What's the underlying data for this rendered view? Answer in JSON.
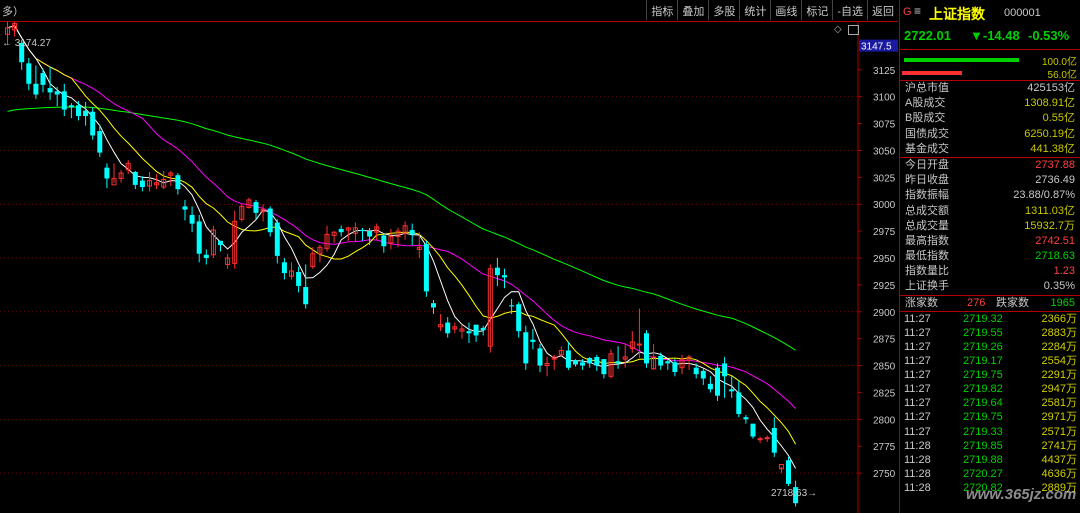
{
  "header": {
    "mode_label": "多）"
  },
  "toolbar": [
    "指标",
    "叠加",
    "多股",
    "统计",
    "画线",
    "标记",
    "-自选",
    "返回"
  ],
  "chart": {
    "high_label": "3174.27",
    "low_label": "2718.63",
    "current_price_tag": "3147.5",
    "y_ticks": [
      "3125",
      "3100",
      "3075",
      "3050",
      "3025",
      "3000",
      "2975",
      "2950",
      "2925",
      "2900",
      "2875",
      "2850",
      "2825",
      "2800",
      "2775",
      "2750"
    ]
  },
  "chart_data": {
    "type": "candlestick",
    "ylim": [
      2725,
      3162
    ],
    "candles": [
      [
        3158,
        3164,
        3148,
        3174
      ],
      [
        3162,
        3168,
        3156,
        3174
      ],
      [
        3150,
        3132,
        3125,
        3152
      ],
      [
        3131,
        3112,
        3106,
        3136
      ],
      [
        3112,
        3102,
        3098,
        3129
      ],
      [
        3122,
        3111,
        3104,
        3126
      ],
      [
        3108,
        3104,
        3097,
        3128
      ],
      [
        3105,
        3102,
        3091,
        3109
      ],
      [
        3105,
        3088,
        3082,
        3112
      ],
      [
        3092,
        3090,
        3080,
        3094
      ],
      [
        3092,
        3082,
        3078,
        3096
      ],
      [
        3087,
        3082,
        3073,
        3095
      ],
      [
        3086,
        3064,
        3060,
        3090
      ],
      [
        3068,
        3048,
        3044,
        3074
      ],
      [
        3034,
        3024,
        3015,
        3038
      ],
      [
        3018,
        3024,
        3020,
        3038
      ],
      [
        3024,
        3029,
        3020,
        3032
      ],
      [
        3032,
        3038,
        3028,
        3041
      ],
      [
        3030,
        3018,
        3014,
        3031
      ],
      [
        3022,
        3016,
        3012,
        3026
      ],
      [
        3017,
        3022,
        3012,
        3030
      ],
      [
        3018,
        3020,
        3014,
        3028
      ],
      [
        3016,
        3023,
        3014,
        3031
      ],
      [
        3027,
        3029,
        3017,
        3031
      ],
      [
        3027,
        3014,
        3009,
        3029
      ],
      [
        2998,
        2995,
        2985,
        3004
      ],
      [
        2990,
        2982,
        2974,
        2998
      ],
      [
        2984,
        2954,
        2946,
        2990
      ],
      [
        2953,
        2950,
        2944,
        2958
      ],
      [
        2953,
        2976,
        2950,
        2980
      ],
      [
        2966,
        2962,
        2956,
        2966
      ],
      [
        2944,
        2950,
        2940,
        2954
      ],
      [
        2945,
        2984,
        2940,
        2994
      ],
      [
        2986,
        2998,
        2984,
        3000
      ],
      [
        2997,
        3004,
        2996,
        3006
      ],
      [
        3002,
        2992,
        2986,
        3004
      ],
      [
        2993,
        2995,
        2984,
        3000
      ],
      [
        2996,
        2974,
        2970,
        2998
      ],
      [
        2983,
        2952,
        2945,
        2986
      ],
      [
        2946,
        2936,
        2930,
        2950
      ],
      [
        2933,
        2938,
        2930,
        2946
      ],
      [
        2937,
        2924,
        2918,
        2942
      ],
      [
        2923,
        2907,
        2903,
        2944
      ],
      [
        2942,
        2954,
        2940,
        2960
      ],
      [
        2954,
        2960,
        2946,
        2962
      ],
      [
        2959,
        2972,
        2956,
        2980
      ],
      [
        2971,
        2974,
        2964,
        2975
      ],
      [
        2977,
        2974,
        2970,
        2980
      ],
      [
        2976,
        2978,
        2966,
        2979
      ],
      [
        2973,
        2978,
        2965,
        2983
      ],
      [
        2976,
        2975,
        2966,
        2978
      ],
      [
        2975,
        2970,
        2962,
        2978
      ],
      [
        2974,
        2979,
        2967,
        2982
      ],
      [
        2971,
        2961,
        2955,
        2973
      ],
      [
        2964,
        2970,
        2958,
        2977
      ],
      [
        2970,
        2975,
        2960,
        2978
      ],
      [
        2973,
        2980,
        2967,
        2984
      ],
      [
        2976,
        2972,
        2962,
        2982
      ],
      [
        2958,
        2960,
        2950,
        2974
      ],
      [
        2963,
        2919,
        2914,
        2966
      ],
      [
        2908,
        2904,
        2898,
        2911
      ],
      [
        2886,
        2888,
        2882,
        2898
      ],
      [
        2890,
        2880,
        2876,
        2895
      ],
      [
        2884,
        2886,
        2880,
        2890
      ],
      [
        2882,
        2884,
        2875,
        2888
      ],
      [
        2882,
        2880,
        2871,
        2890
      ],
      [
        2888,
        2878,
        2872,
        2888
      ],
      [
        2885,
        2883,
        2878,
        2887
      ],
      [
        2868,
        2940,
        2862,
        2944
      ],
      [
        2941,
        2934,
        2924,
        2950
      ],
      [
        2934,
        2932,
        2922,
        2940
      ],
      [
        2906,
        2905,
        2898,
        2912
      ],
      [
        2907,
        2882,
        2876,
        2909
      ],
      [
        2881,
        2852,
        2846,
        2887
      ],
      [
        2874,
        2872,
        2865,
        2884
      ],
      [
        2866,
        2850,
        2844,
        2870
      ],
      [
        2850,
        2852,
        2840,
        2858
      ],
      [
        2856,
        2858,
        2846,
        2860
      ],
      [
        2860,
        2864,
        2858,
        2868
      ],
      [
        2864,
        2848,
        2846,
        2872
      ],
      [
        2855,
        2851,
        2849,
        2856
      ],
      [
        2853,
        2850,
        2846,
        2856
      ],
      [
        2857,
        2852,
        2848,
        2858
      ],
      [
        2858,
        2850,
        2845,
        2860
      ],
      [
        2856,
        2842,
        2838,
        2856
      ],
      [
        2840,
        2861,
        2838,
        2865
      ],
      [
        2854,
        2852,
        2847,
        2868
      ],
      [
        2856,
        2858,
        2848,
        2870
      ],
      [
        2866,
        2872,
        2862,
        2882
      ],
      [
        2870,
        2870,
        2857,
        2903
      ],
      [
        2880,
        2852,
        2848,
        2883
      ],
      [
        2847,
        2858,
        2846,
        2870
      ],
      [
        2859,
        2850,
        2846,
        2862
      ],
      [
        2854,
        2852,
        2846,
        2856
      ],
      [
        2853,
        2844,
        2840,
        2856
      ],
      [
        2848,
        2856,
        2842,
        2860
      ],
      [
        2855,
        2858,
        2846,
        2860
      ],
      [
        2848,
        2842,
        2838,
        2852
      ],
      [
        2845,
        2838,
        2832,
        2848
      ],
      [
        2833,
        2828,
        2825,
        2840
      ],
      [
        2848,
        2822,
        2817,
        2852
      ],
      [
        2852,
        2840,
        2820,
        2858
      ],
      [
        2828,
        2826,
        2820,
        2840
      ],
      [
        2825,
        2805,
        2802,
        2836
      ],
      [
        2802,
        2800,
        2796,
        2804
      ],
      [
        2796,
        2784,
        2782,
        2794
      ],
      [
        2782,
        2782,
        2778,
        2784
      ],
      [
        2782,
        2783,
        2779,
        2785
      ],
      [
        2792,
        2769,
        2765,
        2802
      ],
      [
        2754,
        2758,
        2750,
        2756
      ],
      [
        2762,
        2740,
        2738,
        2765
      ],
      [
        2737,
        2722,
        2719,
        2743
      ]
    ]
  },
  "panel": {
    "name": "上证指数",
    "code": "000001",
    "price": "2722.01",
    "change": "▼-14.48",
    "change_pct": "-0.53%",
    "bar_top": "100.0亿",
    "bar_bottom": "56.0亿",
    "stats1": [
      {
        "label": "沪总市值",
        "value": "425153亿",
        "color": "#c8c8c8"
      },
      {
        "label": "A股成交",
        "value": "1308.91亿",
        "color": "#c8c800"
      },
      {
        "label": "B股成交",
        "value": "0.55亿",
        "color": "#c8c800"
      },
      {
        "label": "国债成交",
        "value": "6250.19亿",
        "color": "#c8c800"
      },
      {
        "label": "基金成交",
        "value": "441.38亿",
        "color": "#c8c800"
      }
    ],
    "stats2": [
      {
        "label": "今日开盘",
        "value": "2737.88",
        "color": "#ff4040"
      },
      {
        "label": "昨日收盘",
        "value": "2736.49",
        "color": "#c8c8c8"
      },
      {
        "label": "指数振幅",
        "value": "23.88/0.87%",
        "color": "#c8c8c8"
      },
      {
        "label": "总成交额",
        "value": "1311.03亿",
        "color": "#c8c800"
      },
      {
        "label": "总成交量",
        "value": "15932.7万",
        "color": "#c8c800"
      },
      {
        "label": "最高指数",
        "value": "2742.51",
        "color": "#ff4040"
      },
      {
        "label": "最低指数",
        "value": "2718.63",
        "color": "#00d000"
      },
      {
        "label": "指数量比",
        "value": "1.23",
        "color": "#ff4040"
      },
      {
        "label": "上证换手",
        "value": "0.35%",
        "color": "#c8c8c8"
      }
    ],
    "rise_label": "涨家数",
    "rise_value": "276",
    "fall_label": "跌家数",
    "fall_value": "1965",
    "ticks": [
      {
        "t": "11:27",
        "p": "2719.32",
        "v": "2366万"
      },
      {
        "t": "11:27",
        "p": "2719.55",
        "v": "2883万"
      },
      {
        "t": "11:27",
        "p": "2719.26",
        "v": "2284万"
      },
      {
        "t": "11:27",
        "p": "2719.17",
        "v": "2554万"
      },
      {
        "t": "11:27",
        "p": "2719.75",
        "v": "2291万"
      },
      {
        "t": "11:27",
        "p": "2719.82",
        "v": "2947万"
      },
      {
        "t": "11:27",
        "p": "2719.64",
        "v": "2581万"
      },
      {
        "t": "11:27",
        "p": "2719.75",
        "v": "2971万"
      },
      {
        "t": "11:27",
        "p": "2719.33",
        "v": "2571万"
      },
      {
        "t": "11:28",
        "p": "2719.85",
        "v": "2741万"
      },
      {
        "t": "11:28",
        "p": "2719.88",
        "v": "4437万"
      },
      {
        "t": "11:28",
        "p": "2720.27",
        "v": "4636万"
      },
      {
        "t": "11:28",
        "p": "2720.82",
        "v": "2889万"
      }
    ],
    "watermark": "www.365jz.com"
  },
  "colors": {
    "up": "#ff3030",
    "down": "#00ffff",
    "ma5": "#ffffff",
    "ma10": "#ffff00",
    "ma20": "#ff00ff",
    "ma60": "#00ff00"
  }
}
